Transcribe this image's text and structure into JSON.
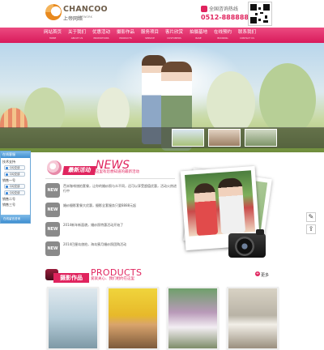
{
  "brand": {
    "name": "CHANCOO",
    "sub_cn": "上帝网络",
    "sub_en": "NETWORK"
  },
  "hotline": {
    "label": "全国咨询热线",
    "number": "0512-88888888"
  },
  "nav": [
    {
      "cn": "网站首页",
      "en": "HOME"
    },
    {
      "cn": "关于我们",
      "en": "ABOUT US"
    },
    {
      "cn": "优惠活动",
      "en": "PROMOTIONS"
    },
    {
      "cn": "摄影作品",
      "en": "PRODUCTS"
    },
    {
      "cn": "服务项目",
      "en": "SERVICE"
    },
    {
      "cn": "客片欣赏",
      "en": "CUSTOMERS"
    },
    {
      "cn": "拍摄基地",
      "en": "BASE"
    },
    {
      "cn": "在线预约",
      "en": "BOOKING"
    },
    {
      "cn": "联系我们",
      "en": "CONTACT US"
    }
  ],
  "side_service": {
    "title": "在线客服",
    "group1": "技术支持",
    "qq1": "QQ交谈",
    "qq2": "QQ交谈",
    "group2": "销售一号",
    "qq3": "QQ交谈",
    "qq4": "QQ交谈",
    "group3": "销售二号",
    "group4": "销售三号",
    "footer": "在线留言咨询"
  },
  "tools": {
    "edit_icon": "edit-icon",
    "share_icon": "share-icon"
  },
  "news": {
    "title_cn": "最新活动",
    "title_en": "NEWS",
    "tagline": "这里有您想知道的最新活动",
    "badge": "NEW",
    "items": [
      "芭米咖啡旅拍套餐，让你的婚纱照与众不同，还可以享受超值优惠，活动火热进行中",
      "婚纱摄影套餐大优惠，摄影全套服务只要8888元起",
      "2014新年新面貌，婚纱照特惠活动开始了",
      "2014巴厘岛旅拍，海岛蜜月婚纱照团购活动"
    ]
  },
  "products": {
    "title_cn": "摄影作品",
    "title_en": "PRODUCTS",
    "tagline": "爱就关心、我们相约在这里",
    "more": "更多"
  },
  "colors": {
    "accent": "#e0245e",
    "nav_top": "#ec4a80",
    "nav_bottom": "#d81b5c",
    "side_blue": "#3f8fd1"
  }
}
